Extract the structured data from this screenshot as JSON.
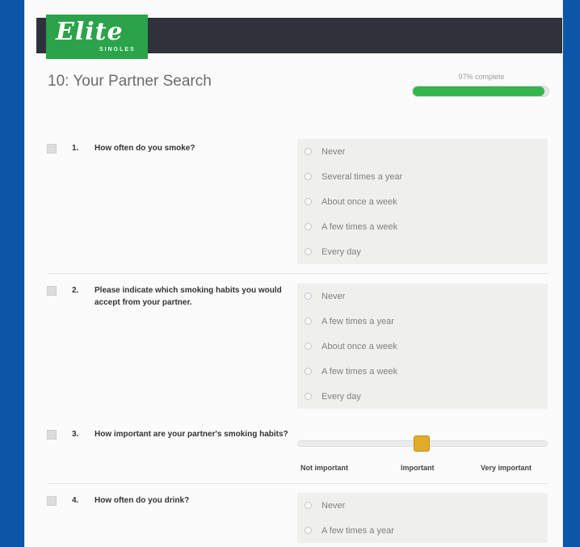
{
  "brand": {
    "logo_script": "Elite",
    "logo_sub": "SINGLES"
  },
  "page": {
    "title": "10: Your Partner Search",
    "progress_label": "97% complete",
    "progress_percent": 97
  },
  "questions": [
    {
      "number": "1.",
      "text": "How often do you smoke?",
      "options": [
        "Never",
        "Several times a year",
        "About once a week",
        "A few times a week",
        "Every day"
      ]
    },
    {
      "number": "2.",
      "text": "Please indicate which smoking habits you would accept from your partner.",
      "options": [
        "Never",
        "A few times a year",
        "About once a week",
        "A few times a week",
        "Every day"
      ]
    },
    {
      "number": "3.",
      "text": "How important are your partner's smoking habits?",
      "slider": {
        "labels": [
          "Not important",
          "Important",
          "Very important"
        ],
        "value_index": 1
      }
    },
    {
      "number": "4.",
      "text": "How often do you drink?",
      "options": [
        "Never",
        "A few times a year"
      ]
    }
  ],
  "colors": {
    "background": "#0b56a6",
    "header_bar": "#2f323b",
    "brand_green": "#2aa34a",
    "progress_green": "#36b44d",
    "slider_handle": "#e2ab2a"
  }
}
